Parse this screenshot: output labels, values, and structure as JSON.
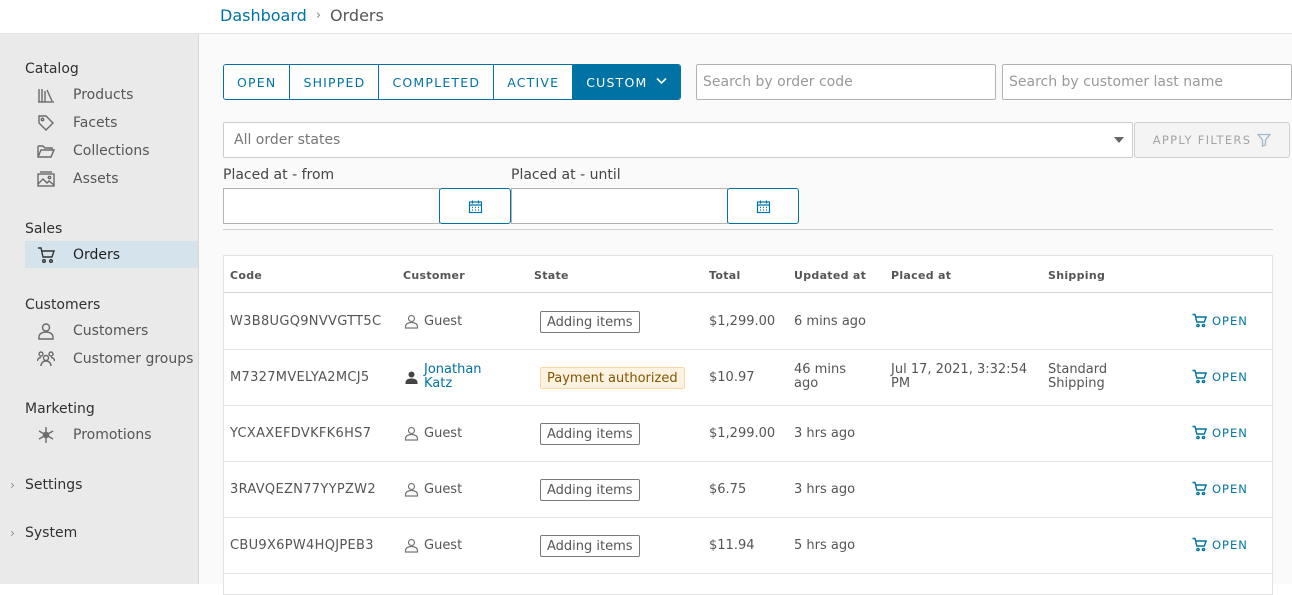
{
  "breadcrumb": {
    "root": "Dashboard",
    "separator": "›",
    "current": "Orders"
  },
  "sidebar": {
    "sections": [
      {
        "title": "Catalog",
        "items": [
          {
            "label": "Products",
            "icon": "products-icon"
          },
          {
            "label": "Facets",
            "icon": "tag-icon"
          },
          {
            "label": "Collections",
            "icon": "folder-open-icon"
          },
          {
            "label": "Assets",
            "icon": "image-gallery-icon"
          }
        ]
      },
      {
        "title": "Sales",
        "items": [
          {
            "label": "Orders",
            "icon": "shopping-cart-icon",
            "active": true
          }
        ]
      },
      {
        "title": "Customers",
        "items": [
          {
            "label": "Customers",
            "icon": "user-icon"
          },
          {
            "label": "Customer groups",
            "icon": "users-icon"
          }
        ]
      },
      {
        "title": "Marketing",
        "items": [
          {
            "label": "Promotions",
            "icon": "asterisk-icon"
          }
        ]
      }
    ],
    "collapsibles": [
      {
        "label": "Settings"
      },
      {
        "label": "System"
      }
    ]
  },
  "filters": {
    "tabs": [
      {
        "label": "OPEN"
      },
      {
        "label": "SHIPPED"
      },
      {
        "label": "COMPLETED"
      },
      {
        "label": "ACTIVE"
      },
      {
        "label": "CUSTOM",
        "active": true
      }
    ],
    "search_code_placeholder": "Search by order code",
    "search_customer_placeholder": "Search by customer last name",
    "order_states_placeholder": "All order states",
    "apply_label": "APPLY FILTERS",
    "placed_from_label": "Placed at - from",
    "placed_until_label": "Placed at - until"
  },
  "table": {
    "headers": [
      "Code",
      "Customer",
      "State",
      "Total",
      "Updated at",
      "Placed at",
      "Shipping"
    ],
    "open_label": "OPEN",
    "rows": [
      {
        "code": "W3B8UGQ9NVVGTT5C",
        "customer": "Guest",
        "state": "Adding items",
        "total": "$1,299.00",
        "updated": "6 mins ago",
        "placed": "",
        "shipping": ""
      },
      {
        "code": "M7327MVELYA2MCJ5",
        "customer": "Jonathan Katz",
        "state": "Payment authorized",
        "total": "$10.97",
        "updated": "46 mins ago",
        "placed": "Jul 17, 2021, 3:32:54 PM",
        "shipping": "Standard Shipping"
      },
      {
        "code": "YCXAXEFDVKFK6HS7",
        "customer": "Guest",
        "state": "Adding items",
        "total": "$1,299.00",
        "updated": "3 hrs ago",
        "placed": "",
        "shipping": ""
      },
      {
        "code": "3RAVQEZN77YYPZW2",
        "customer": "Guest",
        "state": "Adding items",
        "total": "$6.75",
        "updated": "3 hrs ago",
        "placed": "",
        "shipping": ""
      },
      {
        "code": "CBU9X6PW4HQJPEB3",
        "customer": "Guest",
        "state": "Adding items",
        "total": "$11.94",
        "updated": "5 hrs ago",
        "placed": "",
        "shipping": ""
      }
    ]
  },
  "colors": {
    "accent": "#0072a3",
    "sidebar_bg": "#eaeaea",
    "active_item_bg": "#d5e3ec",
    "warn_badge_bg": "#fef3e0"
  }
}
